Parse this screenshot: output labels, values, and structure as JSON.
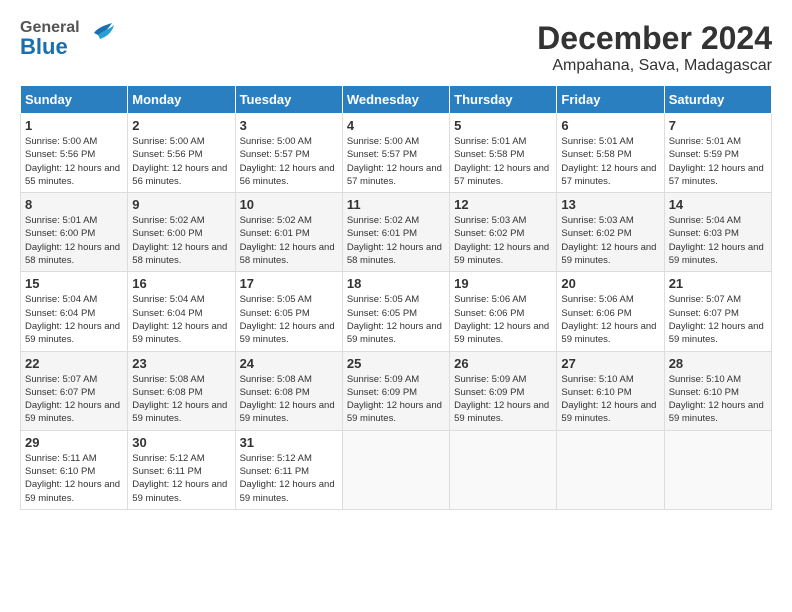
{
  "header": {
    "logo_general": "General",
    "logo_blue": "Blue",
    "title": "December 2024",
    "subtitle": "Ampahana, Sava, Madagascar"
  },
  "calendar": {
    "days_of_week": [
      "Sunday",
      "Monday",
      "Tuesday",
      "Wednesday",
      "Thursday",
      "Friday",
      "Saturday"
    ],
    "weeks": [
      [
        null,
        null,
        null,
        null,
        null,
        null,
        null
      ],
      [
        null,
        null,
        null,
        null,
        null,
        null,
        null
      ]
    ],
    "cells": [
      {
        "day": 1,
        "sunrise": "5:00 AM",
        "sunset": "5:56 PM",
        "daylight": "12 hours and 55 minutes."
      },
      {
        "day": 2,
        "sunrise": "5:00 AM",
        "sunset": "5:56 PM",
        "daylight": "12 hours and 56 minutes."
      },
      {
        "day": 3,
        "sunrise": "5:00 AM",
        "sunset": "5:57 PM",
        "daylight": "12 hours and 56 minutes."
      },
      {
        "day": 4,
        "sunrise": "5:00 AM",
        "sunset": "5:57 PM",
        "daylight": "12 hours and 57 minutes."
      },
      {
        "day": 5,
        "sunrise": "5:01 AM",
        "sunset": "5:58 PM",
        "daylight": "12 hours and 57 minutes."
      },
      {
        "day": 6,
        "sunrise": "5:01 AM",
        "sunset": "5:58 PM",
        "daylight": "12 hours and 57 minutes."
      },
      {
        "day": 7,
        "sunrise": "5:01 AM",
        "sunset": "5:59 PM",
        "daylight": "12 hours and 57 minutes."
      },
      {
        "day": 8,
        "sunrise": "5:01 AM",
        "sunset": "6:00 PM",
        "daylight": "12 hours and 58 minutes."
      },
      {
        "day": 9,
        "sunrise": "5:02 AM",
        "sunset": "6:00 PM",
        "daylight": "12 hours and 58 minutes."
      },
      {
        "day": 10,
        "sunrise": "5:02 AM",
        "sunset": "6:01 PM",
        "daylight": "12 hours and 58 minutes."
      },
      {
        "day": 11,
        "sunrise": "5:02 AM",
        "sunset": "6:01 PM",
        "daylight": "12 hours and 58 minutes."
      },
      {
        "day": 12,
        "sunrise": "5:03 AM",
        "sunset": "6:02 PM",
        "daylight": "12 hours and 59 minutes."
      },
      {
        "day": 13,
        "sunrise": "5:03 AM",
        "sunset": "6:02 PM",
        "daylight": "12 hours and 59 minutes."
      },
      {
        "day": 14,
        "sunrise": "5:04 AM",
        "sunset": "6:03 PM",
        "daylight": "12 hours and 59 minutes."
      },
      {
        "day": 15,
        "sunrise": "5:04 AM",
        "sunset": "6:04 PM",
        "daylight": "12 hours and 59 minutes."
      },
      {
        "day": 16,
        "sunrise": "5:04 AM",
        "sunset": "6:04 PM",
        "daylight": "12 hours and 59 minutes."
      },
      {
        "day": 17,
        "sunrise": "5:05 AM",
        "sunset": "6:05 PM",
        "daylight": "12 hours and 59 minutes."
      },
      {
        "day": 18,
        "sunrise": "5:05 AM",
        "sunset": "6:05 PM",
        "daylight": "12 hours and 59 minutes."
      },
      {
        "day": 19,
        "sunrise": "5:06 AM",
        "sunset": "6:06 PM",
        "daylight": "12 hours and 59 minutes."
      },
      {
        "day": 20,
        "sunrise": "5:06 AM",
        "sunset": "6:06 PM",
        "daylight": "12 hours and 59 minutes."
      },
      {
        "day": 21,
        "sunrise": "5:07 AM",
        "sunset": "6:07 PM",
        "daylight": "12 hours and 59 minutes."
      },
      {
        "day": 22,
        "sunrise": "5:07 AM",
        "sunset": "6:07 PM",
        "daylight": "12 hours and 59 minutes."
      },
      {
        "day": 23,
        "sunrise": "5:08 AM",
        "sunset": "6:08 PM",
        "daylight": "12 hours and 59 minutes."
      },
      {
        "day": 24,
        "sunrise": "5:08 AM",
        "sunset": "6:08 PM",
        "daylight": "12 hours and 59 minutes."
      },
      {
        "day": 25,
        "sunrise": "5:09 AM",
        "sunset": "6:09 PM",
        "daylight": "12 hours and 59 minutes."
      },
      {
        "day": 26,
        "sunrise": "5:09 AM",
        "sunset": "6:09 PM",
        "daylight": "12 hours and 59 minutes."
      },
      {
        "day": 27,
        "sunrise": "5:10 AM",
        "sunset": "6:10 PM",
        "daylight": "12 hours and 59 minutes."
      },
      {
        "day": 28,
        "sunrise": "5:10 AM",
        "sunset": "6:10 PM",
        "daylight": "12 hours and 59 minutes."
      },
      {
        "day": 29,
        "sunrise": "5:11 AM",
        "sunset": "6:10 PM",
        "daylight": "12 hours and 59 minutes."
      },
      {
        "day": 30,
        "sunrise": "5:12 AM",
        "sunset": "6:11 PM",
        "daylight": "12 hours and 59 minutes."
      },
      {
        "day": 31,
        "sunrise": "5:12 AM",
        "sunset": "6:11 PM",
        "daylight": "12 hours and 59 minutes."
      }
    ],
    "start_day_of_week": 0
  }
}
